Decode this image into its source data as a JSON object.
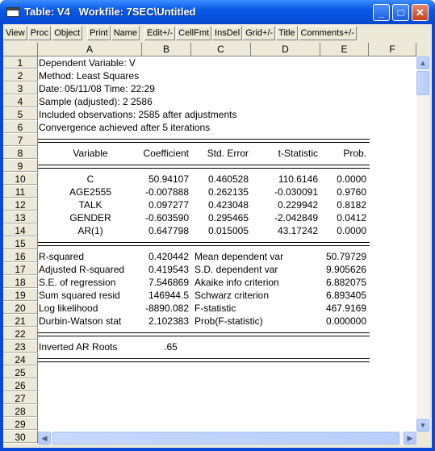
{
  "window": {
    "title": "Table: V4   Workfile: 7SEC\\Untitled",
    "minimize": "_",
    "maximize": "□",
    "close": "✕"
  },
  "toolbar": [
    [
      "View",
      "Proc",
      "Object"
    ],
    [
      "Print",
      "Name"
    ],
    [
      "Edit+/-",
      "CellFmt",
      "InsDel",
      "Grid+/-",
      "Title",
      "Comments+/-"
    ]
  ],
  "columns": [
    "A",
    "B",
    "C",
    "D",
    "E",
    "F"
  ],
  "rows": [
    [
      "Dependent Variable: V",
      "",
      "",
      "",
      "",
      ""
    ],
    [
      "Method: Least Squares",
      "",
      "",
      "",
      "",
      ""
    ],
    [
      "Date: 05/11/08   Time: 22:29",
      "",
      "",
      "",
      "",
      ""
    ],
    [
      "Sample (adjusted): 2 2586",
      "",
      "",
      "",
      "",
      ""
    ],
    [
      "Included observations: 2585 after adjustments",
      "",
      "",
      "",
      "",
      ""
    ],
    [
      "Convergence achieved after 5 iterations",
      "",
      "",
      "",
      "",
      ""
    ],
    [
      "",
      "",
      "",
      "",
      "",
      ""
    ],
    [
      "Variable",
      "Coefficient",
      "Std. Error",
      "t-Statistic",
      "Prob.",
      ""
    ],
    [
      "",
      "",
      "",
      "",
      "",
      ""
    ],
    [
      "C",
      "50.94107",
      "0.460528",
      "110.6146",
      "0.0000",
      ""
    ],
    [
      "AGE2555",
      "-0.007888",
      "0.262135",
      "-0.030091",
      "0.9760",
      ""
    ],
    [
      "TALK",
      "0.097277",
      "0.423048",
      "0.229942",
      "0.8182",
      ""
    ],
    [
      "GENDER",
      "-0.603590",
      "0.295465",
      "-2.042849",
      "0.0412",
      ""
    ],
    [
      "AR(1)",
      "0.647798",
      "0.015005",
      "43.17242",
      "0.0000",
      ""
    ],
    [
      "",
      "",
      "",
      "",
      "",
      ""
    ],
    [
      "R-squared",
      "0.420442",
      "Mean dependent var",
      "",
      "50.79729",
      ""
    ],
    [
      "Adjusted R-squared",
      "0.419543",
      "S.D. dependent var",
      "",
      "9.905626",
      ""
    ],
    [
      "S.E. of regression",
      "7.546869",
      "Akaike info criterion",
      "",
      "6.882075",
      ""
    ],
    [
      "Sum squared resid",
      "146944.5",
      "Schwarz criterion",
      "",
      "6.893405",
      ""
    ],
    [
      "Log likelihood",
      "-8890.082",
      "F-statistic",
      "",
      "467.9169",
      ""
    ],
    [
      "Durbin-Watson stat",
      "2.102383",
      "Prob(F-statistic)",
      "",
      "0.000000",
      ""
    ],
    [
      "",
      "",
      "",
      "",
      "",
      ""
    ],
    [
      "Inverted AR Roots",
      ".65",
      "",
      "",
      "",
      ""
    ],
    [
      "",
      "",
      "",
      "",
      "",
      ""
    ],
    [
      "",
      "",
      "",
      "",
      "",
      ""
    ],
    [
      "",
      "",
      "",
      "",
      "",
      ""
    ],
    [
      "",
      "",
      "",
      "",
      "",
      ""
    ],
    [
      "",
      "",
      "",
      "",
      "",
      ""
    ],
    [
      "",
      "",
      "",
      "",
      "",
      ""
    ],
    [
      "",
      "",
      "",
      "",
      "",
      ""
    ]
  ],
  "scrollbar": {
    "up": "▲",
    "down": "▼",
    "left": "◀",
    "right": "▶"
  }
}
